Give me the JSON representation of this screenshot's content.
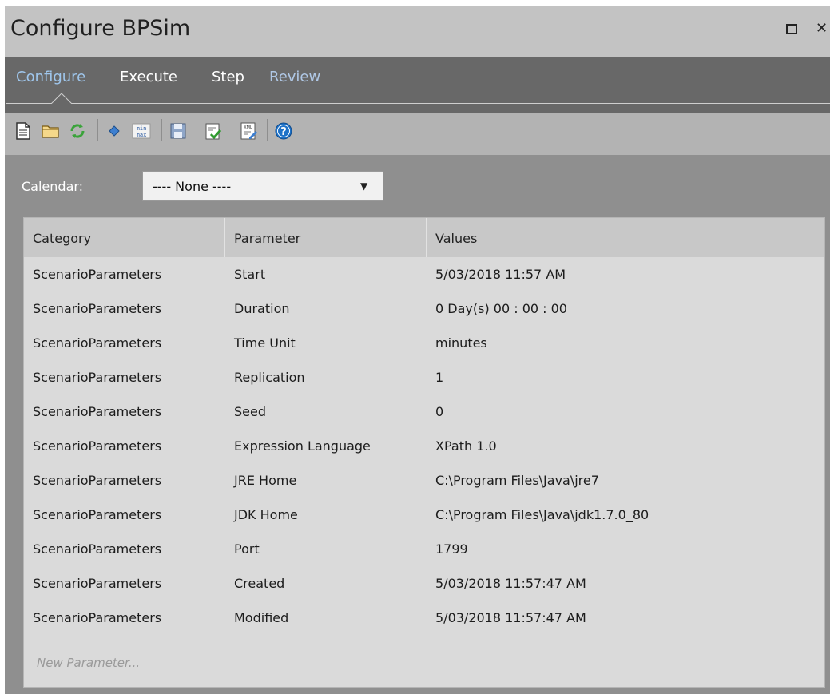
{
  "window": {
    "title": "Configure BPSim",
    "maximize_icon": "maximize-icon",
    "close_symbol": "✕"
  },
  "tabs": [
    {
      "label": "Configure",
      "state": "active"
    },
    {
      "label": "Execute",
      "state": "normal"
    },
    {
      "label": "Step",
      "state": "normal"
    },
    {
      "label": "Review",
      "state": "dim"
    }
  ],
  "toolbar": {
    "icons": [
      "new-document-icon",
      "open-folder-icon",
      "refresh-icon",
      "diamond-icon",
      "min-max-icon",
      "save-icon",
      "validate-icon",
      "xml-export-icon",
      "help-icon"
    ],
    "minmax_top": "min",
    "minmax_bottom": "max",
    "xml_text": "XML",
    "help_text": "?"
  },
  "calendar": {
    "label": "Calendar:",
    "selected": "---- None ----"
  },
  "grid": {
    "columns": [
      "Category",
      "Parameter",
      "Values"
    ],
    "rows": [
      [
        "ScenarioParameters",
        "Start",
        "5/03/2018 11:57 AM"
      ],
      [
        "ScenarioParameters",
        "Duration",
        "0 Day(s) 00 : 00 : 00"
      ],
      [
        "ScenarioParameters",
        "Time Unit",
        "minutes"
      ],
      [
        "ScenarioParameters",
        "Replication",
        "1"
      ],
      [
        "ScenarioParameters",
        "Seed",
        "0"
      ],
      [
        "ScenarioParameters",
        "Expression Language",
        "XPath 1.0"
      ],
      [
        "ScenarioParameters",
        "JRE Home",
        "C:\\Program Files\\Java\\jre7"
      ],
      [
        "ScenarioParameters",
        "JDK Home",
        "C:\\Program Files\\Java\\jdk1.7.0_80"
      ],
      [
        "ScenarioParameters",
        "Port",
        "1799"
      ],
      [
        "ScenarioParameters",
        "Created",
        "5/03/2018 11:57:47 AM"
      ],
      [
        "ScenarioParameters",
        "Modified",
        "5/03/2018 11:57:47 AM"
      ]
    ],
    "new_row_placeholder": "New Parameter..."
  },
  "colors": {
    "active_tab": "#9fc6ec",
    "refresh_green": "#3aa33a",
    "help_blue": "#1e72c8"
  }
}
